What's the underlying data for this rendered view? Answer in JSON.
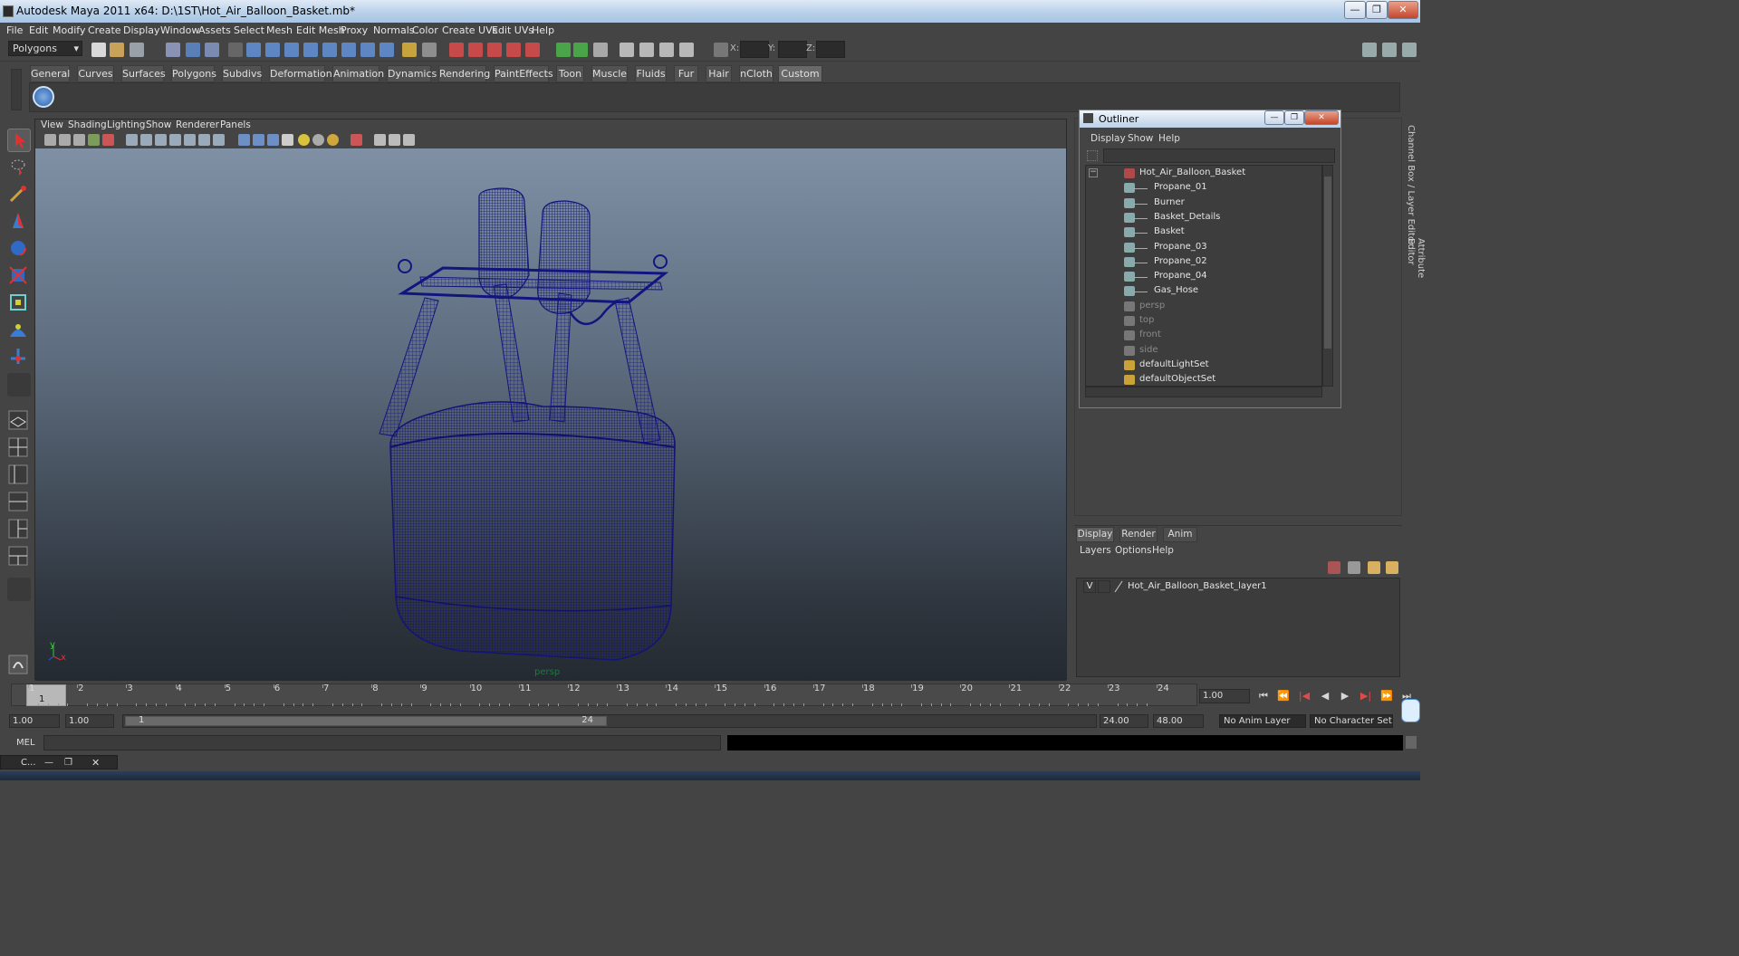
{
  "window": {
    "title": "Autodesk Maya 2011 x64: D:\\1ST\\Hot_Air_Balloon_Basket.mb*",
    "minimize": "—",
    "restore": "❐",
    "close": "✕"
  },
  "menubar": [
    "File",
    "Edit",
    "Modify",
    "Create",
    "Display",
    "Window",
    "Assets",
    "Select",
    "Mesh",
    "Edit Mesh",
    "Proxy",
    "Normals",
    "Color",
    "Create UVs",
    "Edit UVs",
    "Help"
  ],
  "statusline": {
    "mode": "Polygons",
    "x_label": "X:",
    "y_label": "Y:",
    "z_label": "Z:"
  },
  "shelf": {
    "tabs": [
      "General",
      "Curves",
      "Surfaces",
      "Polygons",
      "Subdivs",
      "Deformation",
      "Animation",
      "Dynamics",
      "Rendering",
      "PaintEffects",
      "Toon",
      "Muscle",
      "Fluids",
      "Fur",
      "Hair",
      "nCloth",
      "Custom"
    ],
    "active_tab": "Custom"
  },
  "viewport": {
    "menu": [
      "View",
      "Shading",
      "Lighting",
      "Show",
      "Renderer",
      "Panels"
    ],
    "camera": "persp",
    "axis_y": "y",
    "axis_x": "x",
    "wire_color": "#16167a"
  },
  "outliner": {
    "title": "Outliner",
    "menu": [
      "Display",
      "Show",
      "Help"
    ],
    "collapse": "−",
    "items": [
      {
        "label": "Hot_Air_Balloon_Basket",
        "dim": false
      },
      {
        "label": "Propane_01",
        "dim": false
      },
      {
        "label": "Burner",
        "dim": false
      },
      {
        "label": "Basket_Details",
        "dim": false
      },
      {
        "label": "Basket",
        "dim": false
      },
      {
        "label": "Propane_03",
        "dim": false
      },
      {
        "label": "Propane_02",
        "dim": false
      },
      {
        "label": "Propane_04",
        "dim": false
      },
      {
        "label": "Gas_Hose",
        "dim": false
      },
      {
        "label": "persp",
        "dim": true
      },
      {
        "label": "top",
        "dim": true
      },
      {
        "label": "front",
        "dim": true
      },
      {
        "label": "side",
        "dim": true
      },
      {
        "label": "defaultLightSet",
        "dim": false
      },
      {
        "label": "defaultObjectSet",
        "dim": false
      }
    ]
  },
  "sidetabs": [
    "Channel Box / Layer Editor",
    "Attribute Editor"
  ],
  "layers": {
    "tabs": [
      "Display",
      "Render",
      "Anim"
    ],
    "active_tab": "Display",
    "menu": [
      "Layers",
      "Options",
      "Help"
    ],
    "rows": [
      {
        "visible": "V",
        "name": "Hot_Air_Balloon_Basket_layer1"
      }
    ]
  },
  "timeline": {
    "ticks": [
      "1",
      "2",
      "3",
      "4",
      "5",
      "6",
      "7",
      "8",
      "9",
      "10",
      "11",
      "12",
      "13",
      "14",
      "15",
      "16",
      "17",
      "18",
      "19",
      "20",
      "21",
      "22",
      "23",
      "24"
    ],
    "current_frame": "1.00",
    "current_frame_label": "1"
  },
  "playback": [
    "⏮",
    "⏪",
    "|◀",
    "◀",
    "▶",
    "▶|",
    "⏩",
    "⏭"
  ],
  "range": {
    "start": "1.00",
    "anim_start": "1.00",
    "range_start": "1",
    "range_end": "24",
    "end": "24.00",
    "anim_end": "48.00",
    "anim_layer": "No Anim Layer",
    "char_set": "No Character Set"
  },
  "commandline": {
    "label": "MEL"
  },
  "taskwin": {
    "label": "C..."
  }
}
